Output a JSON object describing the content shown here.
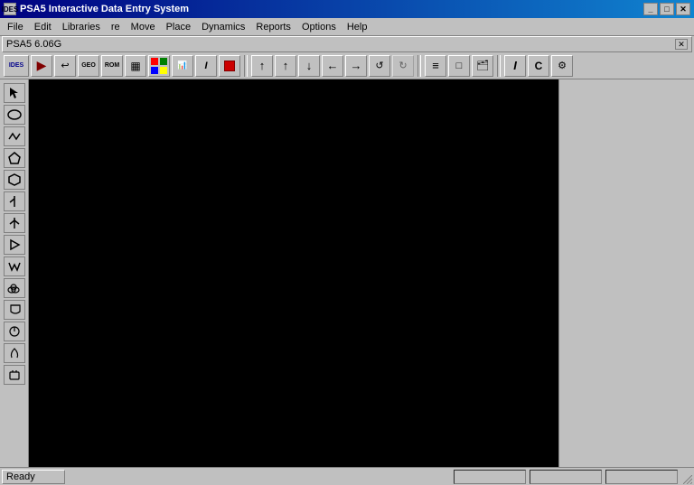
{
  "titleBar": {
    "title": "PSA5 Interactive Data Entry System",
    "iconLabel": "IDES",
    "buttons": [
      "_",
      "□",
      "✕"
    ]
  },
  "menuBar": {
    "items": [
      "File",
      "Edit",
      "Libraries",
      "re",
      "Move",
      "Place",
      "Dynamics",
      "Reports",
      "Options",
      "Help"
    ]
  },
  "subWindow": {
    "title": "PSA5 6.06G",
    "closeBtn": "✕"
  },
  "toolbar": {
    "groups": [
      [
        "IDES",
        "▶",
        "↩",
        "GEO",
        "ROM",
        "▦",
        "🎨",
        "📊",
        "I",
        "🔴"
      ],
      [
        "↑",
        "↑",
        "↓",
        "←",
        "→",
        "↺",
        "↻"
      ],
      [
        "≡",
        "□",
        "🗂"
      ],
      [
        "I",
        "C",
        "⚙"
      ]
    ]
  },
  "sidebar": {
    "tools": [
      "arrow",
      "ellipse",
      "lines",
      "pentagon",
      "hexagon",
      "branch-left",
      "branch-both",
      "play",
      "w-shape",
      "cloud",
      "cup",
      "tool-unknown1",
      "tool-unknown2",
      "tool-unknown3"
    ]
  },
  "statusBar": {
    "status": "Ready",
    "panels": [
      "",
      "",
      "",
      ""
    ]
  }
}
